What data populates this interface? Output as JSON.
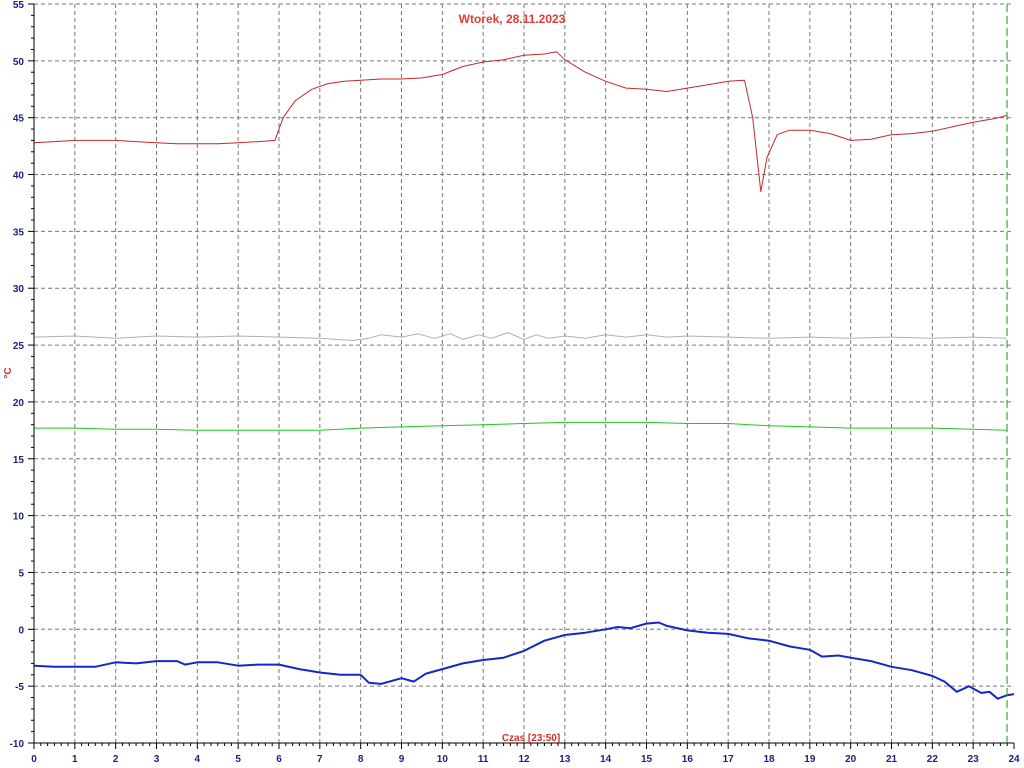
{
  "chart_data": {
    "type": "line",
    "title": "Wtorek, 28.11.2023",
    "xlabel": "Czas [23:50]",
    "ylabel": "°C",
    "xlim": [
      0,
      24
    ],
    "ylim": [
      -10,
      55
    ],
    "x_ticks": [
      "0",
      "1",
      "2",
      "3",
      "4",
      "5",
      "6",
      "7",
      "8",
      "9",
      "10",
      "11",
      "12",
      "13",
      "14",
      "15",
      "16",
      "17",
      "18",
      "19",
      "20",
      "21",
      "22",
      "23",
      "24"
    ],
    "y_ticks": [
      "-10",
      "-5",
      "0",
      "5",
      "10",
      "15",
      "20",
      "25",
      "30",
      "35",
      "40",
      "45",
      "50",
      "55"
    ],
    "grid": true,
    "current_time_marker": 23.83,
    "series": [
      {
        "color": "#c62828",
        "width": 1,
        "points": [
          [
            0,
            42.8
          ],
          [
            0.5,
            42.9
          ],
          [
            1,
            43.0
          ],
          [
            1.5,
            43.0
          ],
          [
            2,
            43.0
          ],
          [
            2.5,
            42.9
          ],
          [
            3,
            42.8
          ],
          [
            3.5,
            42.7
          ],
          [
            4,
            42.7
          ],
          [
            4.5,
            42.7
          ],
          [
            5,
            42.8
          ],
          [
            5.5,
            42.9
          ],
          [
            5.9,
            43.0
          ],
          [
            6.1,
            45.0
          ],
          [
            6.4,
            46.5
          ],
          [
            6.8,
            47.5
          ],
          [
            7.2,
            48.0
          ],
          [
            7.6,
            48.2
          ],
          [
            8,
            48.3
          ],
          [
            8.5,
            48.4
          ],
          [
            9,
            48.4
          ],
          [
            9.5,
            48.5
          ],
          [
            10,
            48.8
          ],
          [
            10.5,
            49.5
          ],
          [
            11,
            49.9
          ],
          [
            11.5,
            50.1
          ],
          [
            12,
            50.5
          ],
          [
            12.5,
            50.6
          ],
          [
            12.8,
            50.8
          ],
          [
            13,
            50.1
          ],
          [
            13.5,
            49.0
          ],
          [
            14,
            48.2
          ],
          [
            14.5,
            47.6
          ],
          [
            15,
            47.5
          ],
          [
            15.5,
            47.3
          ],
          [
            16,
            47.6
          ],
          [
            16.5,
            47.9
          ],
          [
            17,
            48.2
          ],
          [
            17.4,
            48.3
          ],
          [
            17.6,
            45.0
          ],
          [
            17.8,
            38.5
          ],
          [
            17.95,
            41.5
          ],
          [
            18.2,
            43.5
          ],
          [
            18.5,
            43.9
          ],
          [
            19,
            43.9
          ],
          [
            19.5,
            43.6
          ],
          [
            20,
            43.0
          ],
          [
            20.5,
            43.1
          ],
          [
            21,
            43.5
          ],
          [
            21.5,
            43.6
          ],
          [
            22,
            43.8
          ],
          [
            22.5,
            44.2
          ],
          [
            23,
            44.6
          ],
          [
            23.5,
            44.9
          ],
          [
            23.83,
            45.2
          ]
        ]
      },
      {
        "color": "#b0b0b0",
        "width": 1,
        "points": [
          [
            0,
            25.7
          ],
          [
            1,
            25.8
          ],
          [
            2,
            25.6
          ],
          [
            3,
            25.8
          ],
          [
            4,
            25.7
          ],
          [
            5,
            25.8
          ],
          [
            6,
            25.7
          ],
          [
            7,
            25.6
          ],
          [
            7.8,
            25.4
          ],
          [
            8.2,
            25.6
          ],
          [
            8.5,
            25.9
          ],
          [
            9,
            25.7
          ],
          [
            9.4,
            26.0
          ],
          [
            9.8,
            25.6
          ],
          [
            10.2,
            26.0
          ],
          [
            10.5,
            25.5
          ],
          [
            10.9,
            25.9
          ],
          [
            11.2,
            25.6
          ],
          [
            11.6,
            26.1
          ],
          [
            12,
            25.5
          ],
          [
            12.3,
            25.9
          ],
          [
            12.6,
            25.6
          ],
          [
            13,
            25.8
          ],
          [
            13.5,
            25.6
          ],
          [
            14,
            25.9
          ],
          [
            14.5,
            25.7
          ],
          [
            15,
            25.9
          ],
          [
            15.5,
            25.7
          ],
          [
            16,
            25.8
          ],
          [
            17,
            25.7
          ],
          [
            18,
            25.6
          ],
          [
            19,
            25.7
          ],
          [
            20,
            25.6
          ],
          [
            21,
            25.7
          ],
          [
            22,
            25.6
          ],
          [
            23,
            25.7
          ],
          [
            23.83,
            25.6
          ]
        ]
      },
      {
        "color": "#1ec81e",
        "width": 1,
        "points": [
          [
            0,
            17.7
          ],
          [
            1,
            17.7
          ],
          [
            2,
            17.6
          ],
          [
            3,
            17.6
          ],
          [
            4,
            17.5
          ],
          [
            5,
            17.5
          ],
          [
            6,
            17.5
          ],
          [
            7,
            17.5
          ],
          [
            8,
            17.7
          ],
          [
            9,
            17.8
          ],
          [
            10,
            17.9
          ],
          [
            11,
            18.0
          ],
          [
            12,
            18.1
          ],
          [
            13,
            18.2
          ],
          [
            14,
            18.2
          ],
          [
            15,
            18.2
          ],
          [
            16,
            18.1
          ],
          [
            17,
            18.1
          ],
          [
            18,
            17.9
          ],
          [
            19,
            17.8
          ],
          [
            20,
            17.7
          ],
          [
            21,
            17.7
          ],
          [
            22,
            17.7
          ],
          [
            23,
            17.6
          ],
          [
            23.83,
            17.5
          ]
        ]
      },
      {
        "color": "#1428c8",
        "width": 2,
        "points": [
          [
            0,
            -3.2
          ],
          [
            0.5,
            -3.3
          ],
          [
            1,
            -3.3
          ],
          [
            1.5,
            -3.3
          ],
          [
            2,
            -2.9
          ],
          [
            2.5,
            -3.0
          ],
          [
            3,
            -2.8
          ],
          [
            3.5,
            -2.8
          ],
          [
            3.7,
            -3.1
          ],
          [
            4,
            -2.9
          ],
          [
            4.5,
            -2.9
          ],
          [
            5,
            -3.2
          ],
          [
            5.5,
            -3.1
          ],
          [
            6,
            -3.1
          ],
          [
            6.5,
            -3.5
          ],
          [
            7,
            -3.8
          ],
          [
            7.5,
            -4.0
          ],
          [
            8,
            -4.0
          ],
          [
            8.2,
            -4.7
          ],
          [
            8.5,
            -4.8
          ],
          [
            9,
            -4.3
          ],
          [
            9.3,
            -4.6
          ],
          [
            9.6,
            -3.9
          ],
          [
            10,
            -3.5
          ],
          [
            10.5,
            -3.0
          ],
          [
            11,
            -2.7
          ],
          [
            11.5,
            -2.5
          ],
          [
            12,
            -1.9
          ],
          [
            12.5,
            -1.0
          ],
          [
            13,
            -0.5
          ],
          [
            13.5,
            -0.3
          ],
          [
            14,
            0.0
          ],
          [
            14.3,
            0.2
          ],
          [
            14.6,
            0.1
          ],
          [
            15,
            0.5
          ],
          [
            15.3,
            0.6
          ],
          [
            15.5,
            0.3
          ],
          [
            16,
            -0.1
          ],
          [
            16.5,
            -0.3
          ],
          [
            17,
            -0.4
          ],
          [
            17.5,
            -0.8
          ],
          [
            18,
            -1.0
          ],
          [
            18.5,
            -1.5
          ],
          [
            19,
            -1.8
          ],
          [
            19.3,
            -2.4
          ],
          [
            19.7,
            -2.3
          ],
          [
            20,
            -2.5
          ],
          [
            20.5,
            -2.8
          ],
          [
            21,
            -3.3
          ],
          [
            21.5,
            -3.6
          ],
          [
            22,
            -4.1
          ],
          [
            22.3,
            -4.6
          ],
          [
            22.6,
            -5.5
          ],
          [
            22.9,
            -5.0
          ],
          [
            23.2,
            -5.6
          ],
          [
            23.4,
            -5.5
          ],
          [
            23.6,
            -6.1
          ],
          [
            23.83,
            -5.8
          ],
          [
            24,
            -5.7
          ]
        ]
      }
    ]
  }
}
